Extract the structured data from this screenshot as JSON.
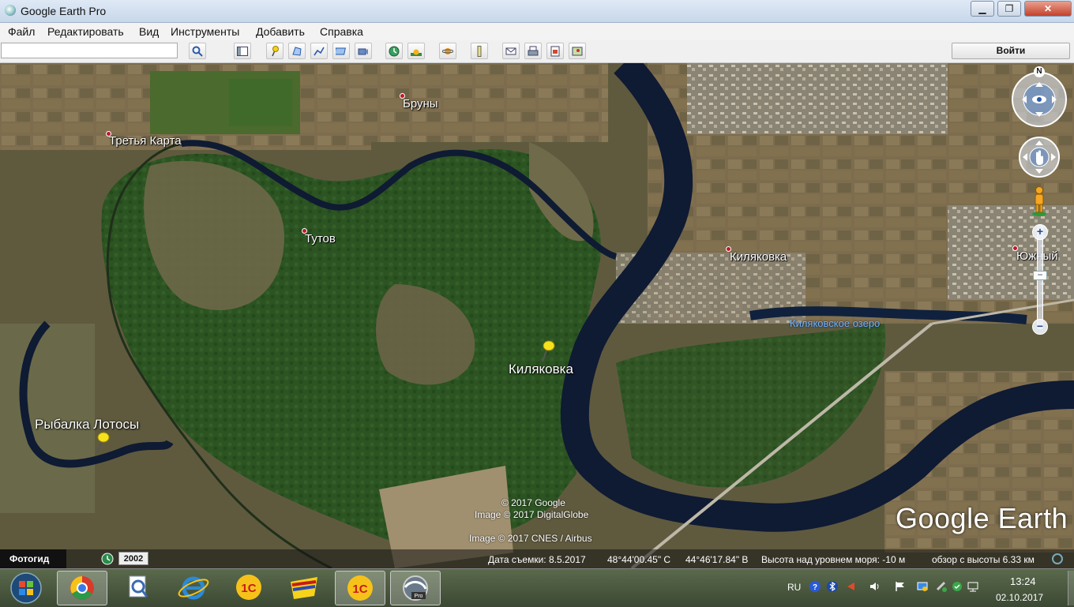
{
  "window": {
    "title": "Google Earth Pro",
    "minimize": "▁",
    "maximize": "❐",
    "close": "✕"
  },
  "menu": [
    "Файл",
    "Редактировать",
    "Вид",
    "Инструменты",
    "Добавить",
    "Справка"
  ],
  "toolbar": {
    "search_value": "",
    "login_label": "Войти"
  },
  "places": {
    "bruny": "Бруны",
    "tretya_karta": "Третья Карта",
    "tutov": "Тутов",
    "kilyakovka_town": "Киляковка",
    "yuzhny": "Южный",
    "kilyakovka_lake": "Киляковское озеро",
    "kilyakovka_pin": "Киляковка",
    "rybalka_pin": "Рыбалка Лотосы"
  },
  "copyright": {
    "google": "© 2017 Google",
    "digitalglobe": "Image © 2017 DigitalGlobe",
    "cnes": "Image © 2017 CNES / Airbus",
    "logo": "Google Earth"
  },
  "status": {
    "tour_guide": "Фотогид",
    "year": "2002",
    "imagery_date": "Дата съемки: 8.5.2017",
    "latitude": "48°44'00.45\" С",
    "longitude": "44°46'17.84\" В",
    "elevation": "Высота над уровнем моря:   -10 м",
    "eye_alt": "обзор с высоты    6.33 км"
  },
  "nav": {
    "north": "N",
    "zoom_in": "+",
    "zoom_out": "−"
  },
  "taskbar": {
    "lang": "RU",
    "time": "13:24",
    "date": "02.10.2017"
  },
  "colors": {
    "river": "#0f1a33",
    "forest": "#2f5a24",
    "fields": "#7a6a4a",
    "accent_red": "#c0182a"
  }
}
